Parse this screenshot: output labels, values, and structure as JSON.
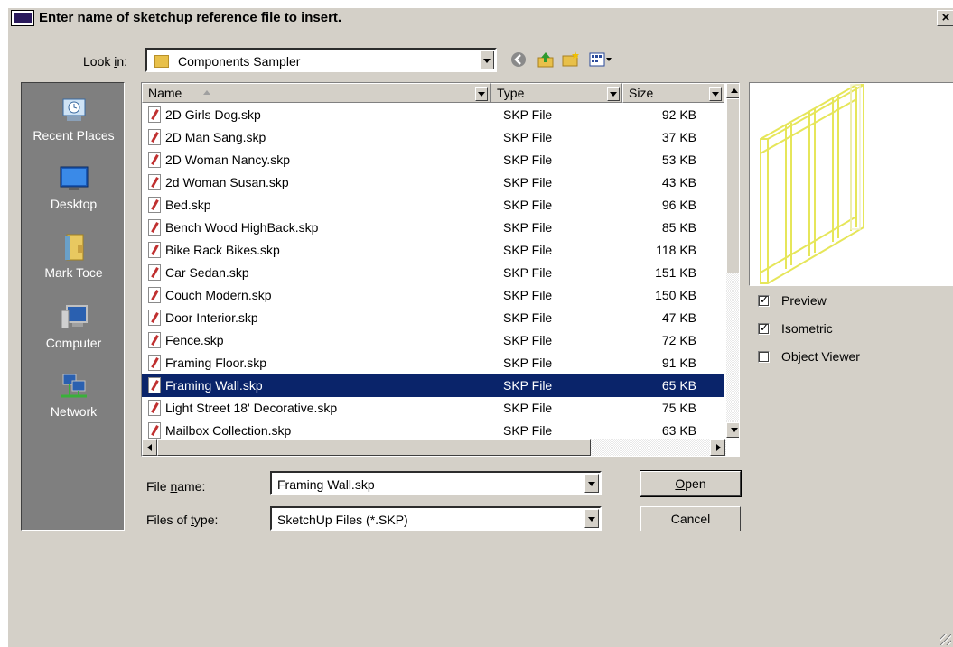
{
  "window": {
    "title": "Enter name of sketchup reference file to insert.",
    "close_label": "×"
  },
  "lookin": {
    "label_pre": "Look ",
    "label_u": "i",
    "label_post": "n:",
    "value": "Components Sampler"
  },
  "toolbar": [
    "back-icon",
    "up-folder-icon",
    "new-folder-icon",
    "view-menu-icon"
  ],
  "places": [
    {
      "label": "Recent Places",
      "icon": "recent-places-icon"
    },
    {
      "label": "Desktop",
      "icon": "desktop-icon"
    },
    {
      "label": "Mark Toce",
      "icon": "user-folder-icon"
    },
    {
      "label": "Computer",
      "icon": "computer-icon"
    },
    {
      "label": "Network",
      "icon": "network-icon"
    }
  ],
  "columns": {
    "name": "Name",
    "type": "Type",
    "size": "Size"
  },
  "files": [
    {
      "name": "2D Girls Dog.skp",
      "type": "SKP File",
      "size": "92 KB"
    },
    {
      "name": "2D Man Sang.skp",
      "type": "SKP File",
      "size": "37 KB"
    },
    {
      "name": "2D Woman Nancy.skp",
      "type": "SKP File",
      "size": "53 KB"
    },
    {
      "name": "2d Woman Susan.skp",
      "type": "SKP File",
      "size": "43 KB"
    },
    {
      "name": "Bed.skp",
      "type": "SKP File",
      "size": "96 KB"
    },
    {
      "name": "Bench Wood HighBack.skp",
      "type": "SKP File",
      "size": "85 KB"
    },
    {
      "name": "Bike Rack Bikes.skp",
      "type": "SKP File",
      "size": "118 KB"
    },
    {
      "name": "Car Sedan.skp",
      "type": "SKP File",
      "size": "151 KB"
    },
    {
      "name": "Couch Modern.skp",
      "type": "SKP File",
      "size": "150 KB"
    },
    {
      "name": "Door Interior.skp",
      "type": "SKP File",
      "size": "47 KB"
    },
    {
      "name": "Fence.skp",
      "type": "SKP File",
      "size": "72 KB"
    },
    {
      "name": "Framing Floor.skp",
      "type": "SKP File",
      "size": "91 KB"
    },
    {
      "name": "Framing Wall.skp",
      "type": "SKP File",
      "size": "65 KB",
      "selected": true
    },
    {
      "name": "Light Street 18' Decorative.skp",
      "type": "SKP File",
      "size": "75 KB"
    },
    {
      "name": "Mailbox Collection.skp",
      "type": "SKP File",
      "size": "63 KB"
    }
  ],
  "options": {
    "preview": {
      "label": "Preview",
      "checked": true
    },
    "isometric": {
      "label": "Isometric",
      "checked": true
    },
    "object_viewer": {
      "label": "Object Viewer",
      "checked": false
    }
  },
  "filename": {
    "label_pre": "File ",
    "label_u": "n",
    "label_post": "ame:",
    "value": "Framing Wall.skp"
  },
  "filetype": {
    "label_pre": "Files of ",
    "label_u": "t",
    "label_post": "ype:",
    "value": "SketchUp Files (*.SKP)"
  },
  "buttons": {
    "open_u": "O",
    "open_rest": "pen",
    "cancel": "Cancel"
  },
  "colors": {
    "selection": "#0a246a",
    "dialog_bg": "#d4d0c8",
    "places_bg": "#7f7f7f",
    "preview_stroke": "#e6e65a"
  }
}
